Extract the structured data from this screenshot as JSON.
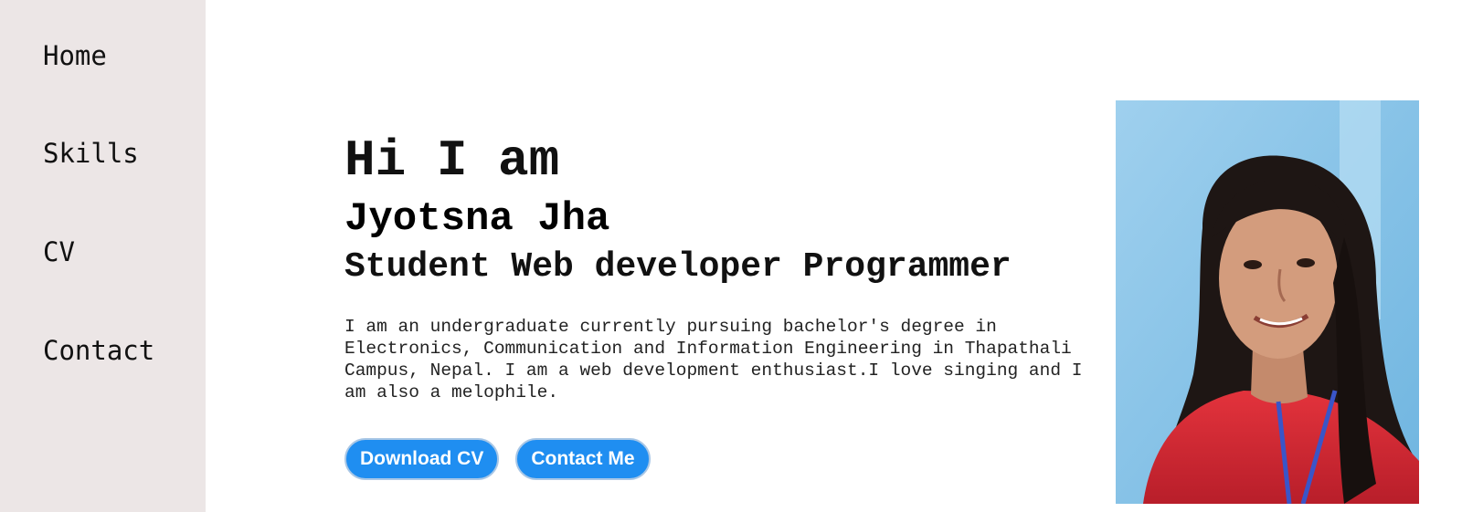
{
  "nav": {
    "items": [
      {
        "label": "Home"
      },
      {
        "label": "Skills"
      },
      {
        "label": "CV"
      },
      {
        "label": "Contact"
      }
    ]
  },
  "hero": {
    "greeting": "Hi I am",
    "name": "Jyotsna Jha",
    "roles": "Student Web developer Programmer",
    "bio": "I am an undergraduate currently pursuing bachelor's degree in Electronics, Communication and Information Engineering in Thapathali Campus, Nepal. I am a web development enthusiast.I love singing and I am also a melophile.",
    "buttons": {
      "download_cv": "Download CV",
      "contact_me": "Contact Me"
    }
  },
  "colors": {
    "sidebar_bg": "#ece6e6",
    "button_bg": "#1f8ef1",
    "button_text": "#ffffff"
  }
}
